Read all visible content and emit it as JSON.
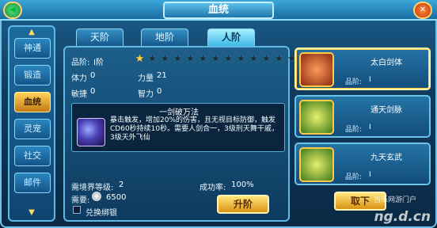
{
  "window": {
    "title": "血统"
  },
  "sidebar": {
    "items": [
      {
        "label": "神通",
        "active": false
      },
      {
        "label": "锻造",
        "active": false
      },
      {
        "label": "血统",
        "active": true
      },
      {
        "label": "灵宠",
        "active": false
      },
      {
        "label": "社交",
        "active": false
      },
      {
        "label": "邮件",
        "active": false
      }
    ]
  },
  "tabs": [
    {
      "label": "天阶",
      "active": false
    },
    {
      "label": "地阶",
      "active": false
    },
    {
      "label": "人阶",
      "active": true
    }
  ],
  "main": {
    "rank_label": "品阶:",
    "rank_value": "I阶",
    "stars_lit": 1,
    "stars_total": 15,
    "stats": [
      {
        "label": "体力",
        "value": "0"
      },
      {
        "label": "力量",
        "value": "21"
      },
      {
        "label": "敏捷",
        "value": "0"
      },
      {
        "label": "智力",
        "value": "0"
      }
    ],
    "skill": {
      "name": "一剑破万法",
      "description": "暴击触发，增加20%的伤害，且无视目标防御，触发CD60秒持续10秒。需要人剑合一，3级刑天舞干戚，3级天外飞仙"
    },
    "required_level_label": "需境界等级:",
    "required_level_value": "2",
    "success_rate_label": "成功率:",
    "success_rate_value": "100%",
    "cost_label": "需要:",
    "cost_value": "6500",
    "exchange_label": "兑换绑银",
    "upgrade_button": "升阶"
  },
  "right_list": [
    {
      "title": "太白剑体",
      "rank_label": "品阶:",
      "rank_value": "I",
      "active": true
    },
    {
      "title": "通天剑脉",
      "rank_label": "品阶:",
      "rank_value": "I",
      "active": false
    },
    {
      "title": "九天玄武",
      "rank_label": "品阶:",
      "rank_value": "I",
      "active": false
    }
  ],
  "equip_button": "取下",
  "watermark": {
    "brand": "ng.d.cn",
    "subtitle": "当乐网游门户"
  },
  "colors": {
    "accent": "#ffcf3c",
    "panel": "#124c7a",
    "border": "#6cc1e6"
  },
  "icons": {
    "currency": "silver-coin-icon",
    "close": "close-icon",
    "back": "back-icon"
  }
}
